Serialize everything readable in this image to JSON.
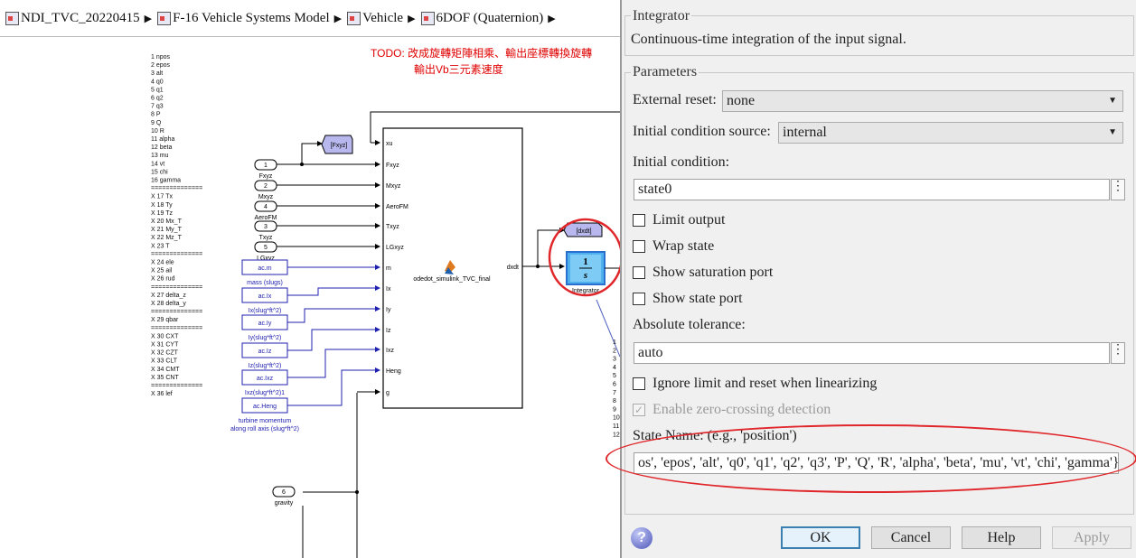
{
  "breadcrumb": [
    {
      "label": "NDI_TVC_20220415",
      "icon": "model-icon"
    },
    {
      "label": "F-16 Vehicle Systems Model",
      "icon": "subsystem-icon"
    },
    {
      "label": "Vehicle",
      "icon": "subsystem-icon"
    },
    {
      "label": "6DOF (Quaternion)",
      "icon": "subsystem-icon"
    }
  ],
  "diagram": {
    "todo_line1": "TODO: 改成旋轉矩陣相乘、輸出座標轉換旋轉",
    "todo_line2": "輸出Vb三元素速度",
    "state_list": [
      "1 npos",
      "2 epos",
      "3 alt",
      "4 q0",
      "5 q1",
      "6 q2",
      "7 q3",
      "8 P",
      "9 Q",
      "10 R",
      "11 alpha",
      "12 beta",
      "13 mu",
      "14 vt",
      "15 chi",
      "16 gamma",
      "==============",
      "X 17 Tx",
      "X 18 Ty",
      "X 19 Tz",
      "X 20 Mx_T",
      "X 21 My_T",
      "X 22 Mz_T",
      "X 23 T",
      "==============",
      "X 24 ele",
      "X 25 ail",
      "X 26 rud",
      "==============",
      "X 27 delta_z",
      "X 28 delta_y",
      "==============",
      "X 29 qbar",
      "==============",
      "X 30 CXT",
      "X 31 CYT",
      "X 32 CZT",
      "X 33 CLT",
      "X 34 CMT",
      "X 35 CNT",
      "==============",
      "X 36 lef"
    ],
    "goto_fxyz": "[Fxyz]",
    "goto_dxdt": "[dxdt]",
    "inports": [
      {
        "num": "1",
        "name": "Fxyz"
      },
      {
        "num": "2",
        "name": "Mxyz"
      },
      {
        "num": "4",
        "name": "AeroFM"
      },
      {
        "num": "3",
        "name": "Txyz"
      },
      {
        "num": "5",
        "name": "LGxyz"
      }
    ],
    "constants": [
      {
        "value": "ac.m",
        "label": "mass (slugs)"
      },
      {
        "value": "ac.Ix",
        "label": "Ix(slug*ft^2)"
      },
      {
        "value": "ac.Iy",
        "label": "Iy(slug*ft^2)"
      },
      {
        "value": "ac.Iz",
        "label": "Iz(slug*ft^2)"
      },
      {
        "value": "ac.Ixz",
        "label": "Ixz(slug*ft^2)1"
      },
      {
        "value": "ac.Heng",
        "label": "turbine momentum",
        "label2": "along roll axis (slug*ft^2)"
      }
    ],
    "fcn_ports": [
      "xu",
      "Fxyz",
      "Mxyz",
      "AeroFM",
      "Txyz",
      "LGxyz",
      "m",
      "Ix",
      "Iy",
      "Iz",
      "Ixz",
      "Heng",
      "g"
    ],
    "fcn_name": "odedot_simulink_TVC_final",
    "fcn_output": "dxdt",
    "integrator_num": "1",
    "integrator_den": "s",
    "integrator_label": "Integrator",
    "gravity_num": "6",
    "gravity_label": "gravity",
    "partial_numbers": [
      "1",
      "2",
      "3",
      "4",
      "5",
      "6",
      "7",
      "8",
      "9",
      "10",
      "11",
      "12"
    ]
  },
  "dialog": {
    "block_title": "Integrator",
    "description": "Continuous-time integration of the input signal.",
    "parameters_legend": "Parameters",
    "external_reset_label": "External reset:",
    "external_reset_value": "none",
    "ic_source_label": "Initial condition source:",
    "ic_source_value": "internal",
    "ic_label": "Initial condition:",
    "ic_value": "state0",
    "limit_output": "Limit output",
    "wrap_state": "Wrap state",
    "show_saturation_port": "Show saturation port",
    "show_state_port": "Show state port",
    "abs_tol_label": "Absolute tolerance:",
    "abs_tol_value": "auto",
    "ignore_limit": "Ignore limit and reset when linearizing",
    "zero_crossing": "Enable zero-crossing detection",
    "state_name_label": "State Name: (e.g., 'position')",
    "state_name_value": "os', 'epos', 'alt', 'q0', 'q1', 'q2', 'q3', 'P', 'Q', 'R', 'alpha', 'beta', 'mu', 'vt', 'chi', 'gamma'}",
    "more_button": "⋮",
    "ok": "OK",
    "cancel": "Cancel",
    "help": "Help",
    "apply": "Apply",
    "highlight_color": "#e0262a",
    "port_color": "#2020b0",
    "goto_color": "#b8b8ee"
  }
}
